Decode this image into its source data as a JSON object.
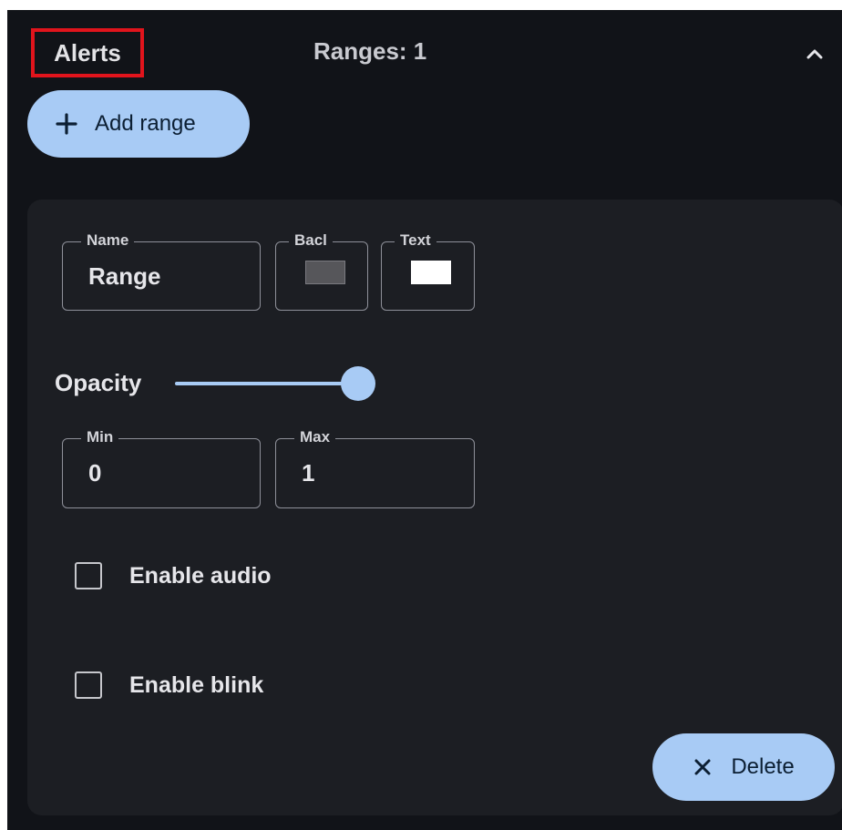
{
  "header": {
    "title": "Alerts",
    "ranges_count": "Ranges: 1",
    "collapse_icon": "chevron-up-icon"
  },
  "toolbar": {
    "add_range_label": "Add range",
    "add_icon": "plus-icon"
  },
  "range": {
    "name_label": "Name",
    "name_value": "Range",
    "background_label": "Bacl",
    "background_color": "#56565a",
    "text_label": "Text",
    "text_color": "#ffffff",
    "opacity_label": "Opacity",
    "opacity_value": 1.0,
    "min_label": "Min",
    "min_value": "0",
    "max_label": "Max",
    "max_value": "1",
    "enable_audio_label": "Enable audio",
    "enable_audio_checked": false,
    "enable_blink_label": "Enable blink",
    "enable_blink_checked": false,
    "delete_label": "Delete",
    "delete_icon": "close-icon"
  },
  "colors": {
    "accent": "#a8cbf5",
    "panel_background": "#111318",
    "card_background": "#1c1e23",
    "highlight_border": "#e1141c"
  }
}
